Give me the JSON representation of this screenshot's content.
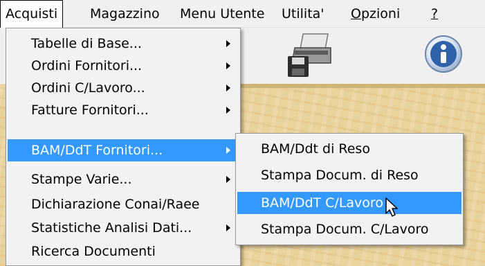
{
  "menubar": {
    "items": [
      {
        "label": "Acquisti"
      },
      {
        "label": "Magazzino"
      },
      {
        "label": "Menu Utente"
      },
      {
        "label": "Utilita'"
      },
      {
        "label_u": "O",
        "label_rest": "pzioni"
      },
      {
        "label": "?"
      }
    ]
  },
  "acquisti_menu": {
    "items": [
      {
        "label": "Tabelle di Base..."
      },
      {
        "label": "Ordini Fornitori..."
      },
      {
        "label": "Ordini C/Lavoro..."
      },
      {
        "label": "Fatture Fornitori..."
      },
      {
        "label": "BAM/DdT Fornitori..."
      },
      {
        "label": "Stampe Varie..."
      },
      {
        "label": "Dichiarazione Conai/Raee"
      },
      {
        "label": "Statistiche Analisi Dati..."
      },
      {
        "label": "Ricerca Documenti"
      }
    ]
  },
  "bam_submenu": {
    "items": [
      {
        "label": "BAM/Ddt di Reso"
      },
      {
        "label": "Stampa Docum. di Reso"
      },
      {
        "label": "BAM/DdT C/Lavoro"
      },
      {
        "label": "Stampa Docum. C/Lavoro"
      }
    ]
  },
  "toolbar": {
    "icons": [
      "globe-icon",
      "printer-icon",
      "info-icon"
    ]
  },
  "colors": {
    "highlight": "#3399ff",
    "desktop": "#e9d39c",
    "menubar": "#f0f0f0"
  }
}
